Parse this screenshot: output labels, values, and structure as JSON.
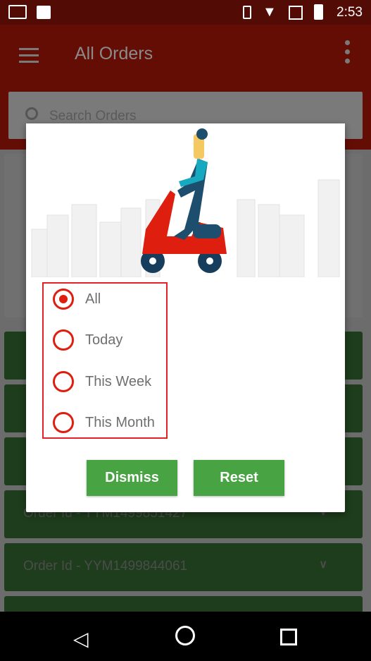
{
  "status_bar": {
    "time": "2:53"
  },
  "app_bar": {
    "title": "All Orders"
  },
  "search": {
    "placeholder": "Search Orders"
  },
  "orders": [
    {
      "label": "Order Id - YYM1499851427"
    },
    {
      "label": "Order Id - YYM1499844061"
    }
  ],
  "dialog": {
    "options": [
      {
        "label": "All",
        "selected": true
      },
      {
        "label": "Today",
        "selected": false
      },
      {
        "label": "This Week",
        "selected": false
      },
      {
        "label": "This Month",
        "selected": false
      }
    ],
    "dismiss_label": "Dismiss",
    "reset_label": "Reset"
  },
  "colors": {
    "accent": "#de1e0e",
    "button": "#48a343",
    "app_bar": "#8b1a0d"
  }
}
